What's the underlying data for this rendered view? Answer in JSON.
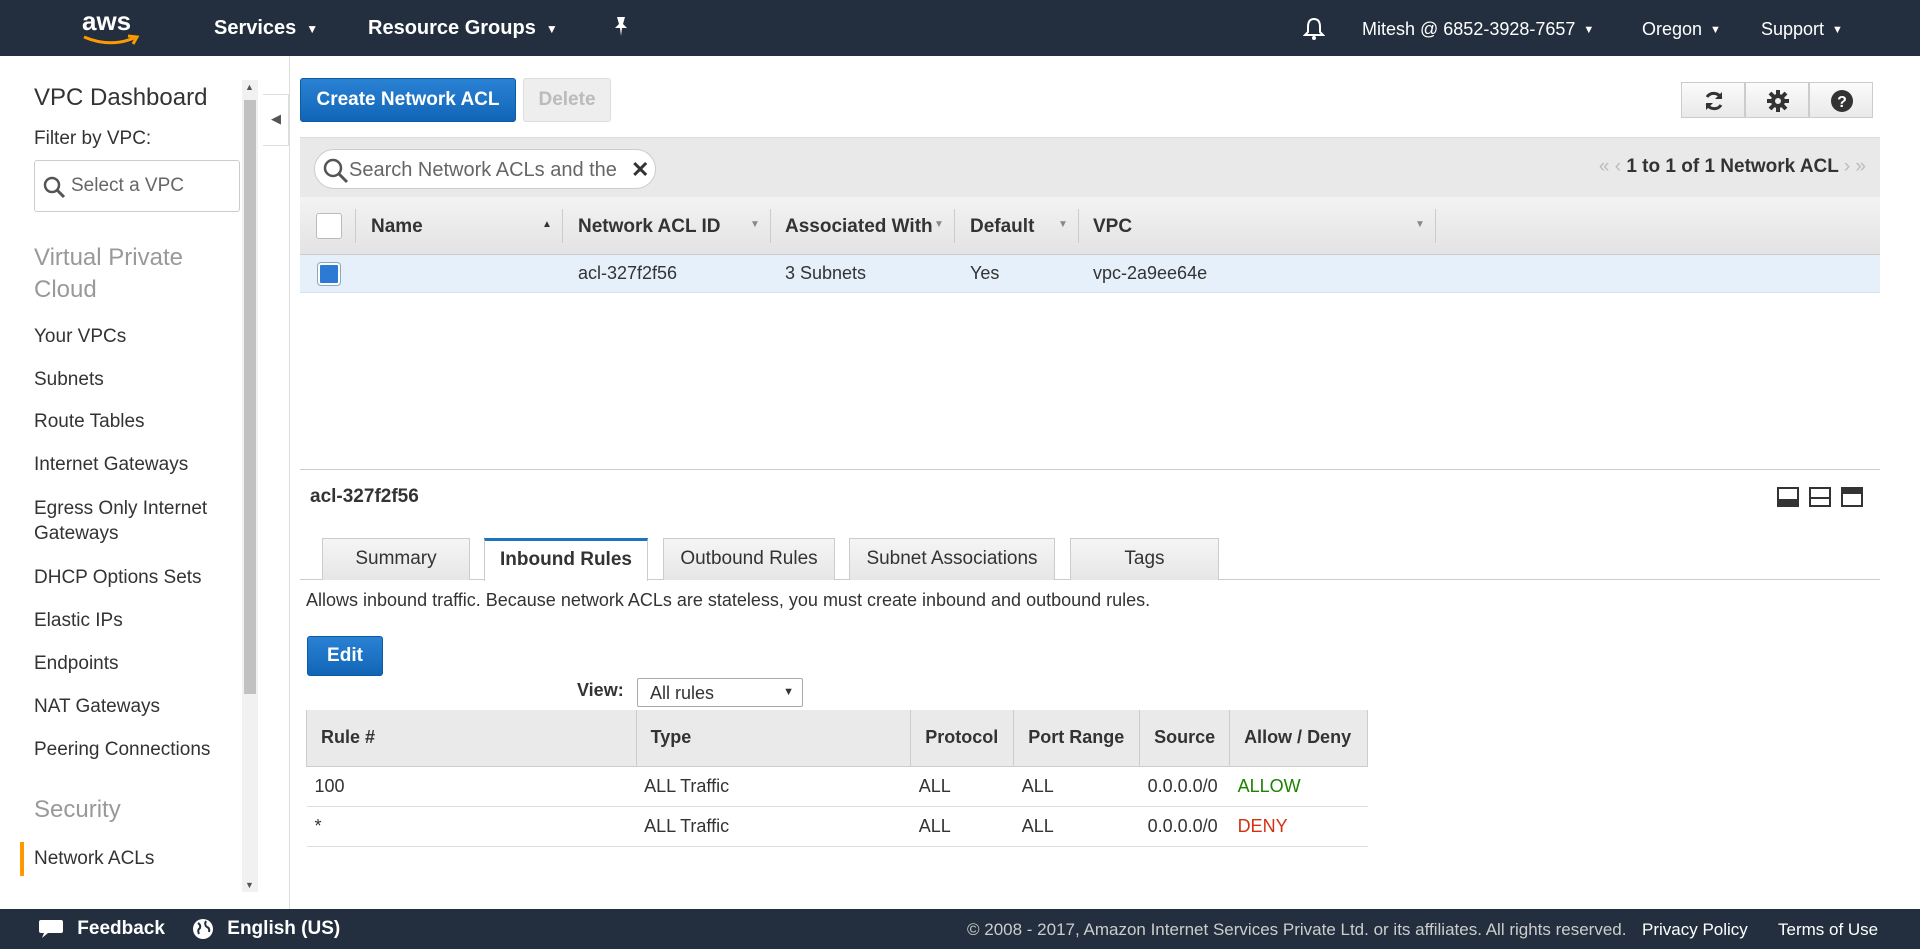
{
  "topnav": {
    "logo": "aws",
    "services": "Services",
    "resource_groups": "Resource Groups",
    "pin_icon": "pin-icon",
    "bell_icon": "bell-icon",
    "account": "Mitesh @ 6852-3928-7657",
    "region": "Oregon",
    "support": "Support"
  },
  "sidebar": {
    "title": "VPC Dashboard",
    "filter_label": "Filter by VPC:",
    "vpc_placeholder": "Select a VPC",
    "section_vpc": "Virtual Private Cloud",
    "items": [
      "Your VPCs",
      "Subnets",
      "Route Tables",
      "Internet Gateways",
      "Egress Only Internet Gateways",
      "DHCP Options Sets",
      "Elastic IPs",
      "Endpoints",
      "NAT Gateways",
      "Peering Connections"
    ],
    "section_security": "Security",
    "active_item": "Network ACLs"
  },
  "toolbar": {
    "create_label": "Create Network ACL",
    "delete_label": "Delete",
    "accent": "#1e73be"
  },
  "search": {
    "placeholder": "Search Network ACLs and the"
  },
  "pager": {
    "text": "1 to 1 of 1 Network ACL"
  },
  "grid": {
    "columns": [
      "Name",
      "Network ACL ID",
      "Associated With",
      "Default",
      "VPC"
    ],
    "rows": [
      {
        "name": "",
        "id": "acl-327f2f56",
        "associated": "3 Subnets",
        "default": "Yes",
        "vpc": "vpc-2a9ee64e",
        "selected": true
      }
    ]
  },
  "detail": {
    "title": "acl-327f2f56",
    "tabs": [
      "Summary",
      "Inbound Rules",
      "Outbound Rules",
      "Subnet Associations",
      "Tags"
    ],
    "active_tab": "Inbound Rules",
    "description": "Allows inbound traffic. Because network ACLs are stateless, you must create inbound and outbound rules.",
    "edit_label": "Edit",
    "view_label": "View:",
    "view_value": "All rules",
    "rules_columns": [
      "Rule #",
      "Type",
      "Protocol",
      "Port Range",
      "Source",
      "Allow / Deny"
    ],
    "rules": [
      {
        "rule": "100",
        "type": "ALL Traffic",
        "protocol": "ALL",
        "port": "ALL",
        "source": "0.0.0.0/0",
        "action": "ALLOW"
      },
      {
        "rule": "*",
        "type": "ALL Traffic",
        "protocol": "ALL",
        "port": "ALL",
        "source": "0.0.0.0/0",
        "action": "DENY"
      }
    ],
    "allow_color": "#1d8102",
    "deny_color": "#d13212"
  },
  "footer": {
    "feedback": "Feedback",
    "language": "English (US)",
    "copyright": "© 2008 - 2017, Amazon Internet Services Private Ltd. or its affiliates. All rights reserved.",
    "privacy": "Privacy Policy",
    "terms": "Terms of Use"
  }
}
